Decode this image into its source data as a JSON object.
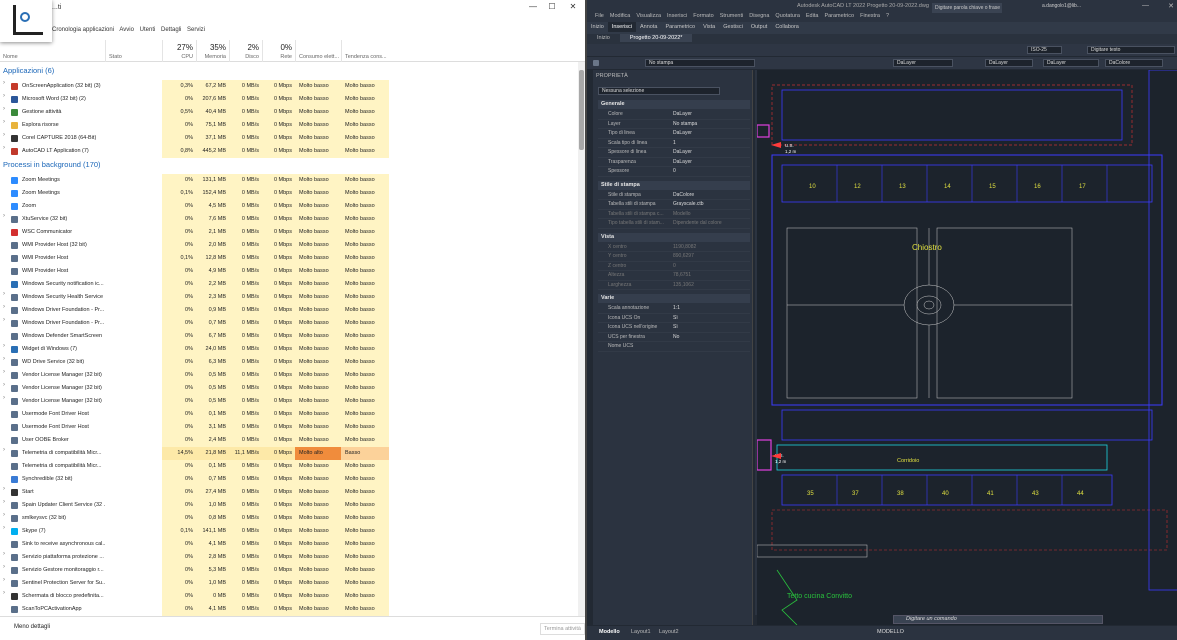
{
  "task_manager": {
    "title": "...ti",
    "menu": [
      "Cronologia applicazioni",
      "Avvio",
      "Utenti",
      "Dettagli",
      "Servizi"
    ],
    "columns": [
      {
        "name": "Nome",
        "pct": ""
      },
      {
        "name": "Stato",
        "pct": ""
      },
      {
        "name": "CPU",
        "pct": "27%"
      },
      {
        "name": "Memoria",
        "pct": "35%"
      },
      {
        "name": "Disco",
        "pct": "2%"
      },
      {
        "name": "Rete",
        "pct": "0%"
      },
      {
        "name": "Consumo elett...",
        "pct": ""
      },
      {
        "name": "Tendenza cons...",
        "pct": ""
      }
    ],
    "group_apps": "Applicazioni (6)",
    "group_bg": "Processi in background (170)",
    "apps": [
      {
        "name": "OnScreenApplication (32 bit) (3)",
        "cpu": "0,3%",
        "mem": "67,2 MB",
        "disk": "0 MB/s",
        "net": "0 Mbps",
        "pow": "Molto basso",
        "trend": "Molto basso",
        "color": "#c53a2a",
        "exp": true
      },
      {
        "name": "Microsoft Word (32 bit) (2)",
        "cpu": "0%",
        "mem": "207,6 MB",
        "disk": "0 MB/s",
        "net": "0 Mbps",
        "pow": "Molto basso",
        "trend": "Molto basso",
        "color": "#2b579a",
        "exp": true
      },
      {
        "name": "Gestione attività",
        "cpu": "0,5%",
        "mem": "40,4 MB",
        "disk": "0 MB/s",
        "net": "0 Mbps",
        "pow": "Molto basso",
        "trend": "Molto basso",
        "color": "#3b8a3b",
        "exp": true
      },
      {
        "name": "Esplora risorse",
        "cpu": "0%",
        "mem": "75,1 MB",
        "disk": "0 MB/s",
        "net": "0 Mbps",
        "pow": "Molto basso",
        "trend": "Molto basso",
        "color": "#e8b33c",
        "exp": true
      },
      {
        "name": "Corel CAPTURE 2018 (64-Bit)",
        "cpu": "0%",
        "mem": "37,1 MB",
        "disk": "0 MB/s",
        "net": "0 Mbps",
        "pow": "Molto basso",
        "trend": "Molto basso",
        "color": "#333333",
        "exp": true
      },
      {
        "name": "AutoCAD LT Application (7)",
        "cpu": "0,8%",
        "mem": "445,2 MB",
        "disk": "0 MB/s",
        "net": "0 Mbps",
        "pow": "Molto basso",
        "trend": "Molto basso",
        "color": "#c0392b",
        "exp": true
      }
    ],
    "background": [
      {
        "name": "Zoom Meetings",
        "cpu": "0%",
        "mem": "131,1 MB",
        "disk": "0 MB/s",
        "net": "0 Mbps",
        "pow": "Molto basso",
        "trend": "Molto basso",
        "color": "#2d8cff",
        "exp": false
      },
      {
        "name": "Zoom Meetings",
        "cpu": "0,1%",
        "mem": "152,4 MB",
        "disk": "0 MB/s",
        "net": "0 Mbps",
        "pow": "Molto basso",
        "trend": "Molto basso",
        "color": "#2d8cff",
        "exp": false
      },
      {
        "name": "Zoom",
        "cpu": "0%",
        "mem": "4,5 MB",
        "disk": "0 MB/s",
        "net": "0 Mbps",
        "pow": "Molto basso",
        "trend": "Molto basso",
        "color": "#2d8cff",
        "exp": false
      },
      {
        "name": "XtuService (32 bit)",
        "cpu": "0%",
        "mem": "7,6 MB",
        "disk": "0 MB/s",
        "net": "0 Mbps",
        "pow": "Molto basso",
        "trend": "Molto basso",
        "color": "#5a6f8a",
        "exp": true
      },
      {
        "name": "WSC Communicator",
        "cpu": "0%",
        "mem": "2,1 MB",
        "disk": "0 MB/s",
        "net": "0 Mbps",
        "pow": "Molto basso",
        "trend": "Molto basso",
        "color": "#d32f2f",
        "exp": false
      },
      {
        "name": "WMI Provider Host (32 bit)",
        "cpu": "0%",
        "mem": "2,0 MB",
        "disk": "0 MB/s",
        "net": "0 Mbps",
        "pow": "Molto basso",
        "trend": "Molto basso",
        "color": "#5a6f8a",
        "exp": false
      },
      {
        "name": "WMI Provider Host",
        "cpu": "0,1%",
        "mem": "12,8 MB",
        "disk": "0 MB/s",
        "net": "0 Mbps",
        "pow": "Molto basso",
        "trend": "Molto basso",
        "color": "#5a6f8a",
        "exp": false
      },
      {
        "name": "WMI Provider Host",
        "cpu": "0%",
        "mem": "4,9 MB",
        "disk": "0 MB/s",
        "net": "0 Mbps",
        "pow": "Molto basso",
        "trend": "Molto basso",
        "color": "#5a6f8a",
        "exp": false
      },
      {
        "name": "Windows Security notification ic...",
        "cpu": "0%",
        "mem": "2,2 MB",
        "disk": "0 MB/s",
        "net": "0 Mbps",
        "pow": "Molto basso",
        "trend": "Molto basso",
        "color": "#2a6fb5",
        "exp": false
      },
      {
        "name": "Windows Security Health Service",
        "cpu": "0%",
        "mem": "2,3 MB",
        "disk": "0 MB/s",
        "net": "0 Mbps",
        "pow": "Molto basso",
        "trend": "Molto basso",
        "color": "#5a6f8a",
        "exp": true
      },
      {
        "name": "Windows Driver Foundation - Pr...",
        "cpu": "0%",
        "mem": "0,9 MB",
        "disk": "0 MB/s",
        "net": "0 Mbps",
        "pow": "Molto basso",
        "trend": "Molto basso",
        "color": "#5a6f8a",
        "exp": true
      },
      {
        "name": "Windows Driver Foundation - Pr...",
        "cpu": "0%",
        "mem": "0,7 MB",
        "disk": "0 MB/s",
        "net": "0 Mbps",
        "pow": "Molto basso",
        "trend": "Molto basso",
        "color": "#5a6f8a",
        "exp": true
      },
      {
        "name": "Windows Defender SmartScreen",
        "cpu": "0%",
        "mem": "6,7 MB",
        "disk": "0 MB/s",
        "net": "0 Mbps",
        "pow": "Molto basso",
        "trend": "Molto basso",
        "color": "#5a6f8a",
        "exp": false
      },
      {
        "name": "Widget di Windows (7)",
        "cpu": "0%",
        "mem": "24,0 MB",
        "disk": "0 MB/s",
        "net": "0 Mbps",
        "pow": "Molto basso",
        "trend": "Molto basso",
        "color": "#2a6fb5",
        "exp": true
      },
      {
        "name": "WD Drive Service (32 bit)",
        "cpu": "0%",
        "mem": "6,3 MB",
        "disk": "0 MB/s",
        "net": "0 Mbps",
        "pow": "Molto basso",
        "trend": "Molto basso",
        "color": "#5a6f8a",
        "exp": true
      },
      {
        "name": "Vendor License Manager (32 bit)",
        "cpu": "0%",
        "mem": "0,5 MB",
        "disk": "0 MB/s",
        "net": "0 Mbps",
        "pow": "Molto basso",
        "trend": "Molto basso",
        "color": "#5a6f8a",
        "exp": true
      },
      {
        "name": "Vendor License Manager (32 bit)",
        "cpu": "0%",
        "mem": "0,5 MB",
        "disk": "0 MB/s",
        "net": "0 Mbps",
        "pow": "Molto basso",
        "trend": "Molto basso",
        "color": "#5a6f8a",
        "exp": true
      },
      {
        "name": "Vendor License Manager (32 bit)",
        "cpu": "0%",
        "mem": "0,5 MB",
        "disk": "0 MB/s",
        "net": "0 Mbps",
        "pow": "Molto basso",
        "trend": "Molto basso",
        "color": "#5a6f8a",
        "exp": true
      },
      {
        "name": "Usermode Font Driver Host",
        "cpu": "0%",
        "mem": "0,1 MB",
        "disk": "0 MB/s",
        "net": "0 Mbps",
        "pow": "Molto basso",
        "trend": "Molto basso",
        "color": "#5a6f8a",
        "exp": false
      },
      {
        "name": "Usermode Font Driver Host",
        "cpu": "0%",
        "mem": "3,1 MB",
        "disk": "0 MB/s",
        "net": "0 Mbps",
        "pow": "Molto basso",
        "trend": "Molto basso",
        "color": "#5a6f8a",
        "exp": false
      },
      {
        "name": "User OOBE Broker",
        "cpu": "0%",
        "mem": "2,4 MB",
        "disk": "0 MB/s",
        "net": "0 Mbps",
        "pow": "Molto basso",
        "trend": "Molto basso",
        "color": "#5a6f8a",
        "exp": false
      },
      {
        "name": "Telemetria di compatibilità Micr...",
        "cpu": "14,5%",
        "mem": "21,8 MB",
        "disk": "11,1 MB/s",
        "net": "0 Mbps",
        "pow": "Molto alto",
        "trend": "Basso",
        "color": "#5a6f8a",
        "exp": true,
        "hot": true
      },
      {
        "name": "Telemetria di compatibilità Micr...",
        "cpu": "0%",
        "mem": "0,1 MB",
        "disk": "0 MB/s",
        "net": "0 Mbps",
        "pow": "Molto basso",
        "trend": "Molto basso",
        "color": "#5a6f8a",
        "exp": false
      },
      {
        "name": "Synchredible (32 bit)",
        "cpu": "0%",
        "mem": "0,7 MB",
        "disk": "0 MB/s",
        "net": "0 Mbps",
        "pow": "Molto basso",
        "trend": "Molto basso",
        "color": "#3a7bd5",
        "exp": false
      },
      {
        "name": "Start",
        "cpu": "0%",
        "mem": "27,4 MB",
        "disk": "0 MB/s",
        "net": "0 Mbps",
        "pow": "Molto basso",
        "trend": "Molto basso",
        "color": "#333333",
        "exp": true
      },
      {
        "name": "Spain Updater Client Service (32 ...",
        "cpu": "0%",
        "mem": "1,0 MB",
        "disk": "0 MB/s",
        "net": "0 Mbps",
        "pow": "Molto basso",
        "trend": "Molto basso",
        "color": "#5a6f8a",
        "exp": true
      },
      {
        "name": "smlkeysvc (32 bit)",
        "cpu": "0%",
        "mem": "0,8 MB",
        "disk": "0 MB/s",
        "net": "0 Mbps",
        "pow": "Molto basso",
        "trend": "Molto basso",
        "color": "#5a6f8a",
        "exp": true
      },
      {
        "name": "Skype (7)",
        "cpu": "0,1%",
        "mem": "141,1 MB",
        "disk": "0 MB/s",
        "net": "0 Mbps",
        "pow": "Molto basso",
        "trend": "Molto basso",
        "color": "#00aff0",
        "exp": true
      },
      {
        "name": "Sink to receive asynchronous cal...",
        "cpu": "0%",
        "mem": "4,1 MB",
        "disk": "0 MB/s",
        "net": "0 Mbps",
        "pow": "Molto basso",
        "trend": "Molto basso",
        "color": "#5a6f8a",
        "exp": false
      },
      {
        "name": "Servizio piattaforma protezione ...",
        "cpu": "0%",
        "mem": "2,8 MB",
        "disk": "0 MB/s",
        "net": "0 Mbps",
        "pow": "Molto basso",
        "trend": "Molto basso",
        "color": "#5a6f8a",
        "exp": true
      },
      {
        "name": "Servizio Gestore monitoraggio r...",
        "cpu": "0%",
        "mem": "5,3 MB",
        "disk": "0 MB/s",
        "net": "0 Mbps",
        "pow": "Molto basso",
        "trend": "Molto basso",
        "color": "#5a6f8a",
        "exp": true
      },
      {
        "name": "Sentinel Protection Server for Su...",
        "cpu": "0%",
        "mem": "1,0 MB",
        "disk": "0 MB/s",
        "net": "0 Mbps",
        "pow": "Molto basso",
        "trend": "Molto basso",
        "color": "#5a6f8a",
        "exp": true
      },
      {
        "name": "Schermata di blocco predefinita...",
        "cpu": "0%",
        "mem": "0 MB",
        "disk": "0 MB/s",
        "net": "0 Mbps",
        "pow": "Molto basso",
        "trend": "Molto basso",
        "color": "#333333",
        "exp": true
      },
      {
        "name": "ScanToPCActivationApp",
        "cpu": "0%",
        "mem": "4,1 MB",
        "disk": "0 MB/s",
        "net": "0 Mbps",
        "pow": "Molto basso",
        "trend": "Molto basso",
        "color": "#5a6f8a",
        "exp": false
      }
    ],
    "footer": {
      "less": "Meno dettagli",
      "end": "Termina attività"
    }
  },
  "autocad": {
    "window_title": "Autodesk AutoCAD LT 2022    Progetto 20-09-2022.dwg",
    "search_placeholder": "Digitare parola chiave o frase",
    "user": "a.dangolo1@lib...",
    "menus": [
      "File",
      "Modifica",
      "Visualizza",
      "Inserisci",
      "Formato",
      "Strumenti",
      "Disegna",
      "Quotatura",
      "Edita",
      "Parametrico",
      "Finestra",
      "?"
    ],
    "ribbon_tabs": [
      "Inizio",
      "Inserisci",
      "Annota",
      "Parametrico",
      "Vista",
      "Gestisci",
      "Output",
      "Collabora"
    ],
    "ribbon_active": "Inserisci",
    "doc_tabs": [
      "Inizio",
      "Progetto 20-09-2022*"
    ],
    "toolbar": {
      "layer": "No stampa",
      "color": "DaLayer",
      "linetype": "DaLayer",
      "lineweight": "DaLayer",
      "plotstyle": "DaColore",
      "scale": "ISO-25",
      "text": "Digitare testo"
    },
    "props_title": "PROPRIETÀ",
    "props_select": "Nessuna selezione",
    "sections": [
      {
        "title": "Generale",
        "rows": [
          [
            "Colore",
            "DaLayer"
          ],
          [
            "Layer",
            "No stampa"
          ],
          [
            "Tipo di linea",
            "DaLayer"
          ],
          [
            "Scala tipo di linea",
            "1"
          ],
          [
            "Spessore di linea",
            "DaLayer"
          ],
          [
            "Trasparenza",
            "DaLayer"
          ],
          [
            "Spessore",
            "0"
          ]
        ]
      },
      {
        "title": "Stile di stampa",
        "rows": [
          [
            "Stile di stampa",
            "DaColore"
          ],
          [
            "Tabella stili di stampa",
            "Grayscale.ctb"
          ],
          [
            "Tabella stili di stampa c...",
            "Modello"
          ],
          [
            "Tipo tabella stili di stam...",
            "Dipendente dal colore"
          ]
        ],
        "dim_from": 2
      },
      {
        "title": "Vista",
        "rows": [
          [
            "X centro",
            "1190,8082"
          ],
          [
            "Y centro",
            "890,6297"
          ],
          [
            "Z centro",
            "0"
          ],
          [
            "Altezza",
            "78,6751"
          ],
          [
            "Larghezza",
            "135,1062"
          ]
        ],
        "dim_from": 0
      },
      {
        "title": "Varie",
        "rows": [
          [
            "Scala annotazione",
            "1:1"
          ],
          [
            "Icona UCS On",
            "Sì"
          ],
          [
            "Icona UCS nell'origine",
            "Sì"
          ],
          [
            "UCS per finestra",
            "No"
          ],
          [
            "Nome UCS",
            ""
          ]
        ]
      }
    ],
    "labels": {
      "chiostro": "Chiostro",
      "corridoio": "Corridoio",
      "tetto": "Tetto cucina Convitto",
      "us": "U.S.",
      "us_h": "1,2 m"
    },
    "rooms_top": [
      "10",
      "12",
      "13",
      "14",
      "15",
      "16",
      "17"
    ],
    "rooms_bottom": [
      "35",
      "37",
      "38",
      "40",
      "41",
      "43",
      "44"
    ],
    "command_placeholder": "Digitare un comando",
    "status_tabs": [
      "Modello",
      "Layout1",
      "Layout2"
    ],
    "status_right": "MODELLO"
  }
}
